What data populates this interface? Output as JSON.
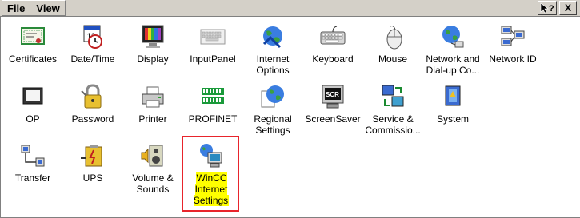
{
  "menu": {
    "file": "File",
    "view": "View"
  },
  "titlebar": {
    "help_glyph": "?",
    "close_glyph": "X"
  },
  "items": [
    {
      "label": "Certificates",
      "icon": "certificate-icon"
    },
    {
      "label": "Date/Time",
      "icon": "calendar-clock-icon"
    },
    {
      "label": "Display",
      "icon": "monitor-icon"
    },
    {
      "label": "InputPanel",
      "icon": "keyboard-panel-icon"
    },
    {
      "label": "Internet\nOptions",
      "icon": "globe-icon"
    },
    {
      "label": "Keyboard",
      "icon": "keyboard-icon"
    },
    {
      "label": "Mouse",
      "icon": "mouse-icon"
    },
    {
      "label": "Network and\nDial-up Co...",
      "icon": "network-globe-icon"
    },
    {
      "label": "Network ID",
      "icon": "network-computers-icon"
    },
    {
      "label": "OP",
      "icon": "operator-panel-icon"
    },
    {
      "label": "Password",
      "icon": "padlock-icon"
    },
    {
      "label": "Printer",
      "icon": "printer-icon"
    },
    {
      "label": "PROFINET",
      "icon": "profinet-icon"
    },
    {
      "label": "Regional\nSettings",
      "icon": "regional-globe-icon"
    },
    {
      "label": "ScreenSaver",
      "icon": "screensaver-icon"
    },
    {
      "label": "Service &\nCommissio...",
      "icon": "service-icon"
    },
    {
      "label": "System",
      "icon": "system-icon"
    },
    {
      "label": "Transfer",
      "icon": "transfer-icon"
    },
    {
      "label": "UPS",
      "icon": "ups-battery-icon"
    },
    {
      "label": "Volume &\nSounds",
      "icon": "speaker-icon"
    },
    {
      "label": "WinCC\nInternet\nSettings",
      "icon": "wincc-internet-icon",
      "selected": true
    }
  ],
  "colors": {
    "selection_fill": "#ffff00",
    "highlight_border": "#e8242c",
    "chrome": "#d4d0c8"
  }
}
